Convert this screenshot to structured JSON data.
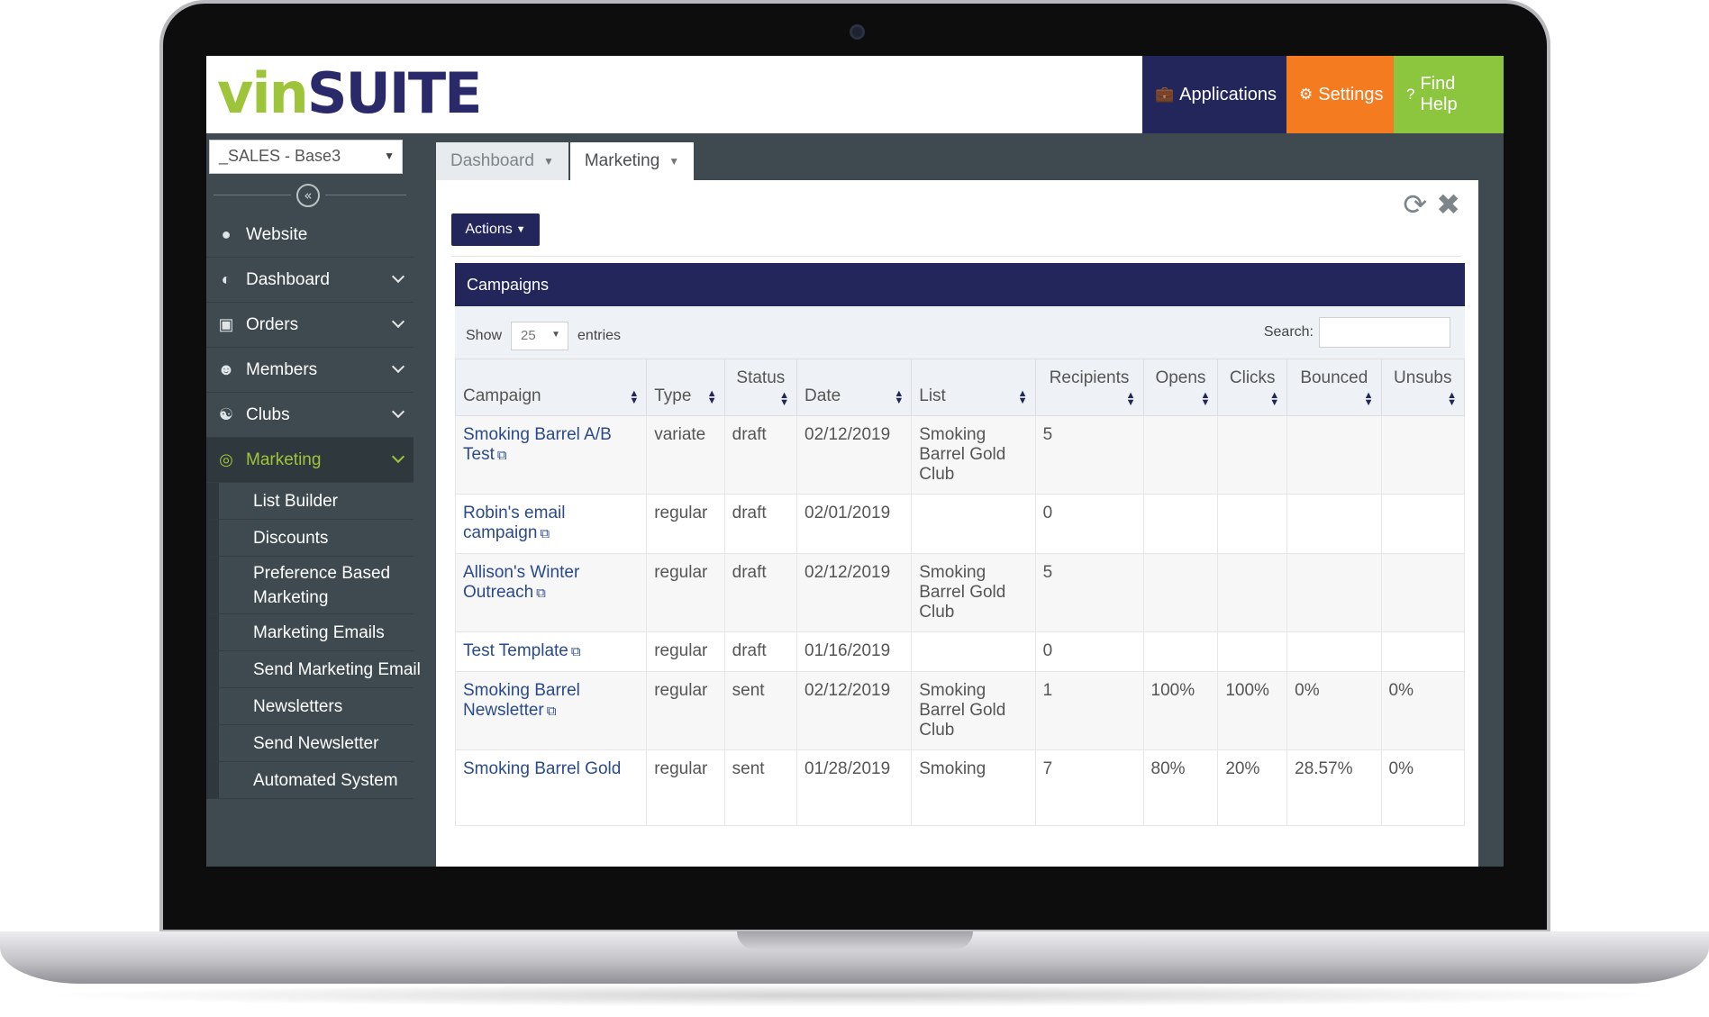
{
  "topbar": {
    "logo_part1": "vin",
    "logo_part2": "SUITE",
    "applications_label": "Applications",
    "settings_label": "Settings",
    "help_label": "Find Help"
  },
  "sidebar": {
    "site_select": "_SALES - Base3",
    "items": [
      {
        "label": "Website",
        "icon": "globe-icon",
        "has_chevron": false
      },
      {
        "label": "Dashboard",
        "icon": "dashboard-icon",
        "has_chevron": true
      },
      {
        "label": "Orders",
        "icon": "cart-icon",
        "has_chevron": true
      },
      {
        "label": "Members",
        "icon": "user-icon",
        "has_chevron": true
      },
      {
        "label": "Clubs",
        "icon": "users-icon",
        "has_chevron": true
      },
      {
        "label": "Marketing",
        "icon": "target-icon",
        "has_chevron": true,
        "active": true
      }
    ],
    "subitems": [
      "List Builder",
      "Discounts",
      "Preference Based Marketing",
      "Marketing Emails",
      "Send Marketing Email",
      "Newsletters",
      "Send Newsletter",
      "Automated System"
    ]
  },
  "tabs": [
    {
      "label": "Dashboard",
      "active": false
    },
    {
      "label": "Marketing",
      "active": true
    }
  ],
  "actions_label": "Actions",
  "campaigns": {
    "title": "Campaigns",
    "show_label": "Show",
    "show_value": "25",
    "entries_label": "entries",
    "search_label": "Search:",
    "columns": [
      "Campaign",
      "Type",
      "Status",
      "Date",
      "List",
      "Recipients",
      "Opens",
      "Clicks",
      "Bounced",
      "Unsubs"
    ],
    "rows": [
      {
        "campaign": "Smoking Barrel A/B Test",
        "type": "variate",
        "status": "draft",
        "date": "02/12/2019",
        "list": "Smoking Barrel Gold Club",
        "recipients": "5",
        "opens": "",
        "clicks": "",
        "bounced": "",
        "unsubs": ""
      },
      {
        "campaign": "Robin's email campaign",
        "type": "regular",
        "status": "draft",
        "date": "02/01/2019",
        "list": "",
        "recipients": "0",
        "opens": "",
        "clicks": "",
        "bounced": "",
        "unsubs": ""
      },
      {
        "campaign": "Allison's Winter Outreach",
        "type": "regular",
        "status": "draft",
        "date": "02/12/2019",
        "list": "Smoking Barrel Gold Club",
        "recipients": "5",
        "opens": "",
        "clicks": "",
        "bounced": "",
        "unsubs": ""
      },
      {
        "campaign": "Test Template",
        "type": "regular",
        "status": "draft",
        "date": "01/16/2019",
        "list": "",
        "recipients": "0",
        "opens": "",
        "clicks": "",
        "bounced": "",
        "unsubs": ""
      },
      {
        "campaign": "Smoking Barrel Newsletter",
        "type": "regular",
        "status": "sent",
        "date": "02/12/2019",
        "list": "Smoking Barrel Gold Club",
        "recipients": "1",
        "opens": "100%",
        "clicks": "100%",
        "bounced": "0%",
        "unsubs": "0%"
      },
      {
        "campaign": "Smoking Barrel Gold",
        "type": "regular",
        "status": "sent",
        "date": "01/28/2019",
        "list": "Smoking",
        "recipients": "7",
        "opens": "80%",
        "clicks": "20%",
        "bounced": "28.57%",
        "unsubs": "0%"
      }
    ]
  }
}
